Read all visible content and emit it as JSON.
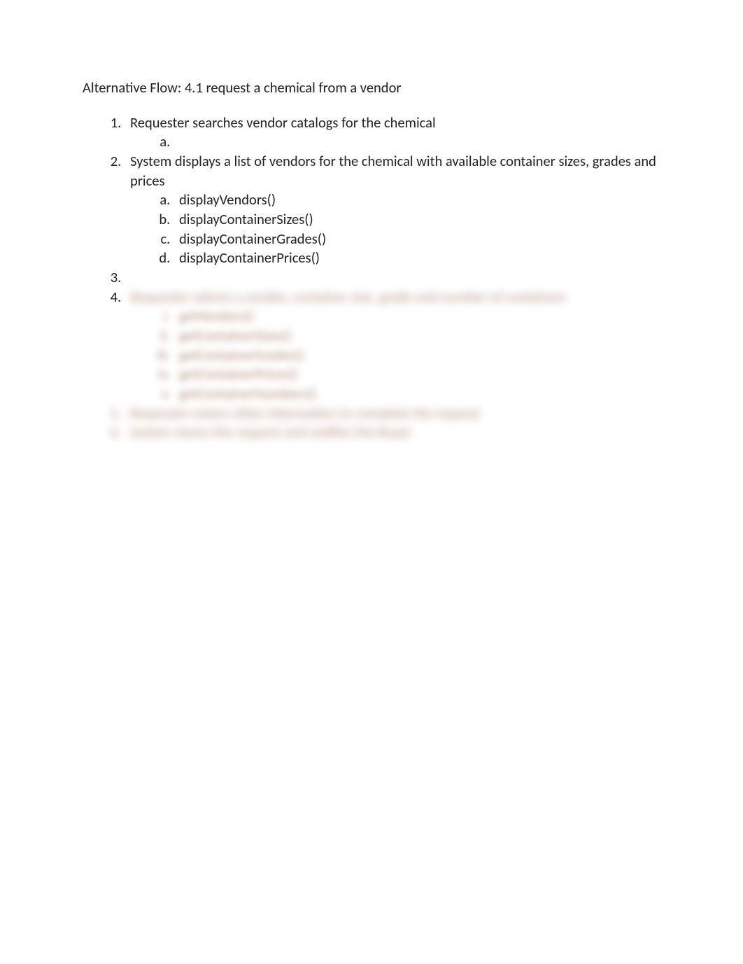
{
  "heading": "Alternative Flow: 4.1 request a chemical from a vendor",
  "items": [
    {
      "text": "Requester searches vendor catalogs for the chemical",
      "sub": [
        {
          "text": ""
        }
      ]
    },
    {
      "text": "System displays a list of vendors for the chemical with available container sizes, grades and prices",
      "sub": [
        {
          "text": "displayVendors()"
        },
        {
          "text": "displayContainerSizes()"
        },
        {
          "text": "displayContainerGrades()"
        },
        {
          "text": "displayContainerPrices()"
        }
      ]
    },
    {
      "text": ""
    },
    {
      "text": "Requester selects a vendor, container size, grade and number of containers",
      "blurred": true,
      "subroman": [
        {
          "text": "getVendors()"
        },
        {
          "text": "getContainerSizes()"
        },
        {
          "text": "getContainerGrades()"
        },
        {
          "text": "getContainerPrices()"
        },
        {
          "text": "getContainerNumbers()"
        }
      ]
    },
    {
      "text": "Requester enters other information to complete the request",
      "blurred": true,
      "hideNum": true
    },
    {
      "text": "System stores the request and notifies the Buyer",
      "blurred": true,
      "hideNum": true
    }
  ]
}
